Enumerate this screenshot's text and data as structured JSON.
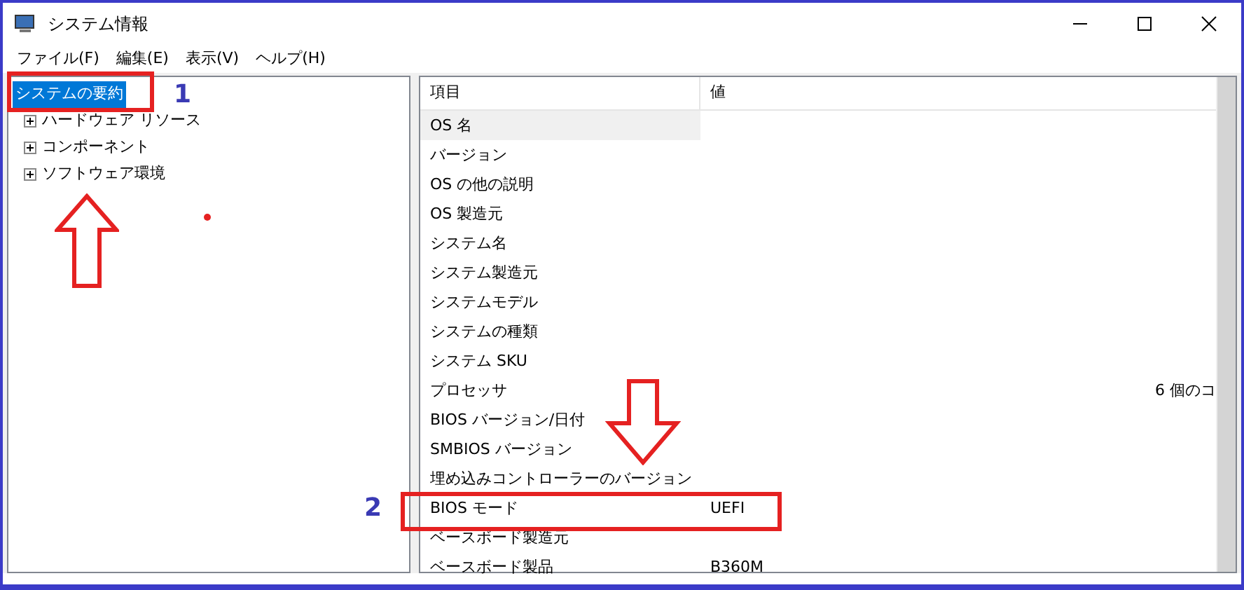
{
  "window": {
    "title": "システム情報"
  },
  "menu": [
    "ファイル(F)",
    "編集(E)",
    "表示(V)",
    "ヘルプ(H)"
  ],
  "tree": {
    "label": "システムの要約",
    "selected": true,
    "children": [
      {
        "label": "ハードウェア リソース",
        "expanded": false
      },
      {
        "label": "コンポーネント",
        "expanded": false
      },
      {
        "label": "ソフトウェア環境",
        "expanded": false
      }
    ]
  },
  "table": {
    "columns": [
      "項目",
      "値"
    ],
    "rows": [
      {
        "item": "OS 名",
        "selected": true
      },
      {
        "item": "バージョン",
        "selected": false
      },
      {
        "item": "OS の他の説明",
        "selected": false
      },
      {
        "item": "OS 製造元",
        "selected": false
      },
      {
        "item": "システム名",
        "selected": false
      },
      {
        "item": "システム製造元",
        "selected": false
      },
      {
        "item": "システムモデル",
        "selected": false
      },
      {
        "item": "システムの種類",
        "selected": false
      },
      {
        "item": "システム SKU",
        "selected": false
      },
      {
        "item": "プロセッサ",
        "value": "6 個のコ",
        "selected": false
      },
      {
        "item": "BIOS バージョン/日付",
        "selected": false
      },
      {
        "item": "SMBIOS バージョン",
        "selected": false
      },
      {
        "item": "埋め込みコントローラーのバージョン",
        "selected": false
      },
      {
        "item": "BIOS モード",
        "value": "UEFI",
        "selected": false
      },
      {
        "item": "ベースボード製造元",
        "selected": false
      },
      {
        "item": "ベースボード製品",
        "value": "B360M",
        "selected": false
      }
    ]
  },
  "annotations": [
    {
      "label": "1"
    },
    {
      "label": "2"
    }
  ]
}
